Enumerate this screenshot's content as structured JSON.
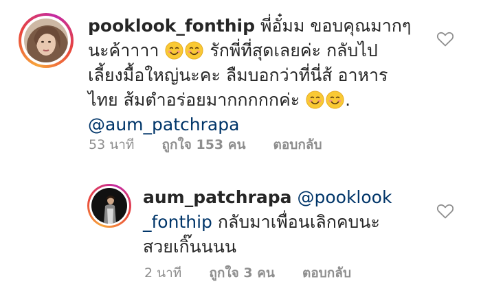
{
  "comments": [
    {
      "username": "pooklook_fonthip",
      "text_line1": "พี่อั๋มม ขอบคุณมากๆ",
      "text_line2a": "นะค้าาาา",
      "text_line2b": "รักพี่ที่สุดเลยค่ะ กลับไป",
      "text_line3": "เลี้ยงมื้อใหญ่นะคะ ลืมบอกว่าที่นี่ส้ อาหาร",
      "text_line4": "ไทย ส้มตำอร่อยมากกกกกค่ะ",
      "text_line4_end": ".",
      "mention": "@aum_patchrapa",
      "time": "53 นาที",
      "likes": "ถูกใจ 153 คน",
      "reply": "ตอบกลับ",
      "emoji": "smiling-face-icon"
    },
    {
      "username": "aum_patchrapa",
      "mention_part1": "@pooklook",
      "mention_part2": "_fonthip",
      "text_line2": "กลับมาเพื่อนเลิกคบนะ",
      "text_line3": "สวยเกิ๊นนนน",
      "time": "2 นาที",
      "likes": "ถูกใจ 3 คน",
      "reply": "ตอบกลับ"
    }
  ],
  "colors": {
    "text": "#262626",
    "meta": "#8e8e8e",
    "mention": "#003569",
    "ring_gradient": [
      "#f7a43b",
      "#e8453c",
      "#c32aa3"
    ]
  }
}
